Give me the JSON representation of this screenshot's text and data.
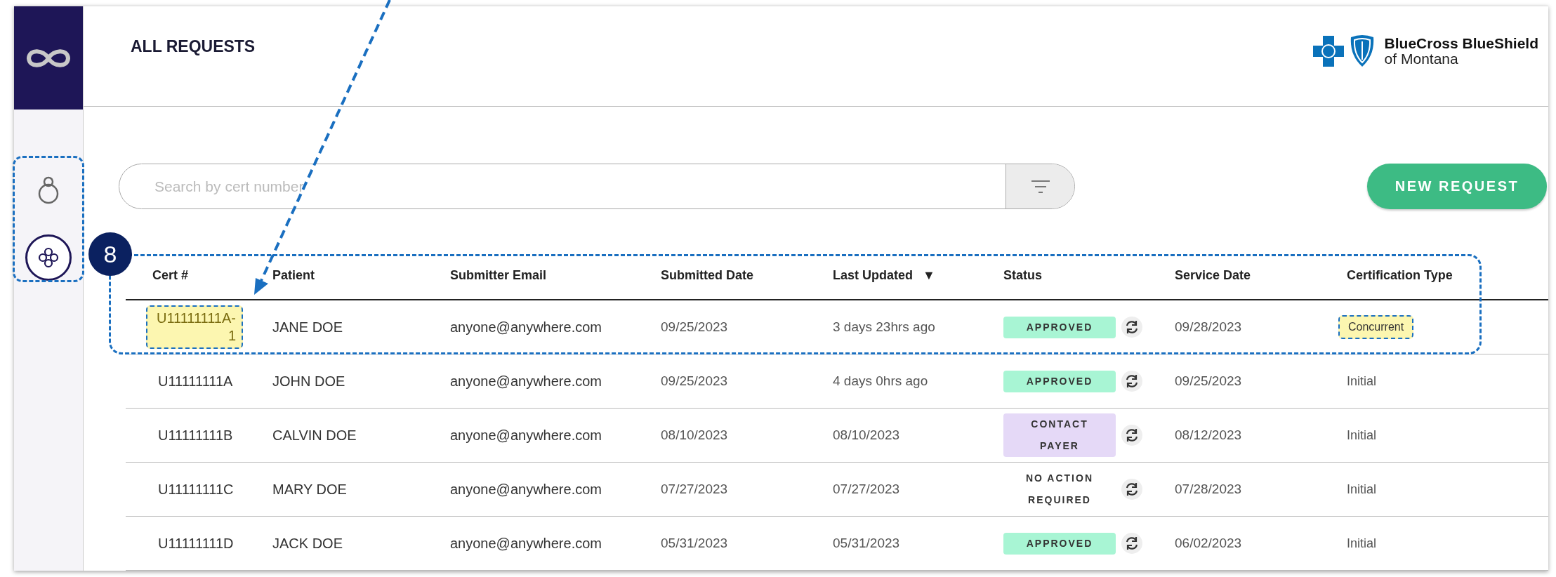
{
  "header": {
    "title": "ALL REQUESTS",
    "brand": {
      "name": "BlueCross BlueShield",
      "region": "of Montana"
    }
  },
  "sidebar": {
    "items": [
      {
        "selected": false
      },
      {
        "selected": true
      }
    ]
  },
  "search": {
    "placeholder": "Search by cert number"
  },
  "new_request_button": "NEW REQUEST",
  "annotation": {
    "number": "8"
  },
  "table": {
    "columns": [
      {
        "label": "Cert #"
      },
      {
        "label": "Patient"
      },
      {
        "label": "Submitter Email"
      },
      {
        "label": "Submitted Date"
      },
      {
        "label": "Last Updated",
        "sort": "▼"
      },
      {
        "label": "Status"
      },
      {
        "label": "Service Date"
      },
      {
        "label": "Certification Type"
      }
    ],
    "rows": [
      {
        "cert": "U11111111A-1",
        "cert_highlighted": true,
        "patient": "JANE DOE",
        "email": "anyone@anywhere.com",
        "submitted": "09/25/2023",
        "updated": "3 days 23hrs ago",
        "status": {
          "kind": "approved",
          "label": "APPROVED"
        },
        "service": "09/28/2023",
        "type": "Concurrent",
        "type_highlighted": true
      },
      {
        "cert": "U11111111A",
        "cert_highlighted": false,
        "patient": "JOHN DOE",
        "email": "anyone@anywhere.com",
        "submitted": "09/25/2023",
        "updated": "4 days 0hrs ago",
        "status": {
          "kind": "approved",
          "label": "APPROVED"
        },
        "service": "09/25/2023",
        "type": "Initial",
        "type_highlighted": false
      },
      {
        "cert": "U11111111B",
        "cert_highlighted": false,
        "patient": "CALVIN DOE",
        "email": "anyone@anywhere.com",
        "submitted": "08/10/2023",
        "updated": "08/10/2023",
        "status": {
          "kind": "contact",
          "label": "CONTACT PAYER"
        },
        "service": "08/12/2023",
        "type": "Initial",
        "type_highlighted": false
      },
      {
        "cert": "U11111111C",
        "cert_highlighted": false,
        "patient": "MARY DOE",
        "email": "anyone@anywhere.com",
        "submitted": "07/27/2023",
        "updated": "07/27/2023",
        "status": {
          "kind": "plain",
          "label": "NO ACTION REQUIRED"
        },
        "service": "07/28/2023",
        "type": "Initial",
        "type_highlighted": false
      },
      {
        "cert": "U11111111D",
        "cert_highlighted": false,
        "patient": "JACK DOE",
        "email": "anyone@anywhere.com",
        "submitted": "05/31/2023",
        "updated": "05/31/2023",
        "status": {
          "kind": "approved",
          "label": "APPROVED"
        },
        "service": "06/02/2023",
        "type": "Initial",
        "type_highlighted": false
      }
    ]
  }
}
